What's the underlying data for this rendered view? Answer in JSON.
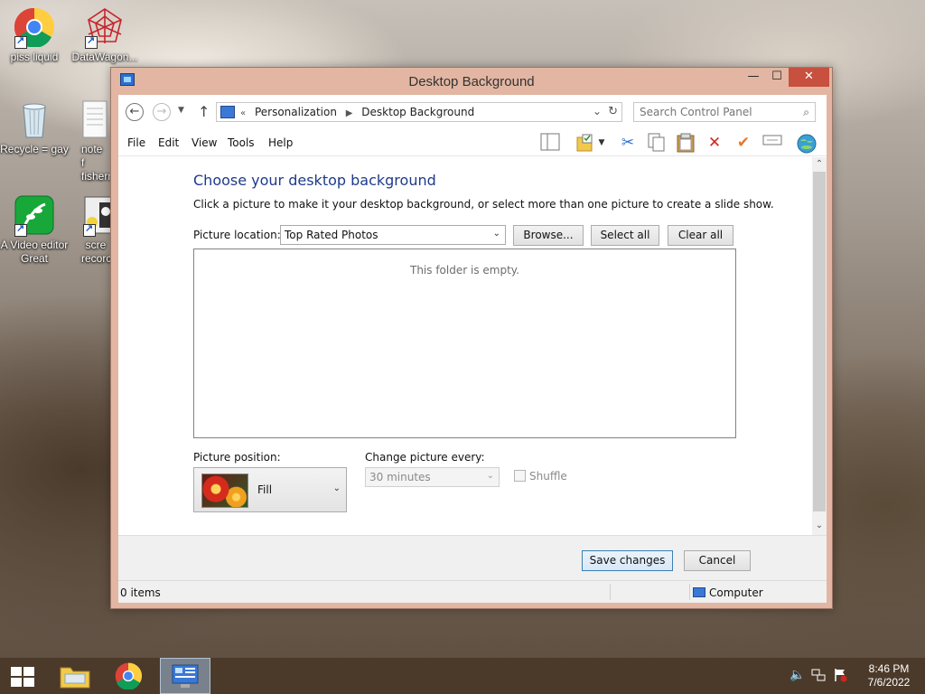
{
  "desktop": {
    "icons": [
      {
        "label": "piss liquid",
        "icon": "chrome-icon"
      },
      {
        "label": "DataWagon...",
        "icon": "datawagon-icon"
      },
      {
        "label": "Recycle = gay",
        "icon": "recycle-bin-icon"
      },
      {
        "label": "note f fishern",
        "icon": "notepad-icon"
      },
      {
        "label": "A Video editor Great",
        "icon": "video-editor-icon"
      },
      {
        "label": "scre recorc",
        "icon": "screen-recorder-icon"
      }
    ]
  },
  "window": {
    "title": "Desktop Background",
    "controls": {
      "minimize": "—",
      "maximize": "☐",
      "close": "✕"
    }
  },
  "address": {
    "overflow": "«",
    "crumbs": [
      "Personalization",
      "Desktop Background"
    ]
  },
  "search": {
    "placeholder": "Search Control Panel"
  },
  "menu": {
    "items": [
      "File",
      "Edit",
      "View",
      "Tools",
      "Help"
    ]
  },
  "toolbar": {
    "icons": [
      "layout-pane-icon",
      "folder-properties-icon",
      "dropdown-arrow-icon",
      "cut-icon",
      "copy-icon",
      "paste-icon",
      "delete-icon",
      "checkmark-icon",
      "rename-icon",
      "globe-icon"
    ]
  },
  "main": {
    "heading": "Choose your desktop background",
    "instructions": "Click a picture to make it your desktop background, or select more than one picture to create a slide show.",
    "picture_location_label": "Picture location:",
    "picture_location_value": "Top Rated Photos",
    "browse_label": "Browse...",
    "select_all_label": "Select all",
    "clear_all_label": "Clear all",
    "empty_message": "This folder is empty.",
    "picture_position_label": "Picture position:",
    "picture_position_value": "Fill",
    "change_every_label": "Change picture every:",
    "change_every_value": "30 minutes",
    "shuffle_label": "Shuffle",
    "shuffle_checked": false
  },
  "footer": {
    "save_label": "Save changes",
    "cancel_label": "Cancel"
  },
  "statusbar": {
    "items": "0 items",
    "location": "Computer"
  },
  "taskbar": {
    "apps": [
      "start-icon",
      "file-explorer-icon",
      "chrome-icon",
      "control-panel-icon"
    ],
    "active_app": "control-panel-icon",
    "time": "8:46 PM",
    "date": "7/6/2022"
  },
  "colors": {
    "window_frame": "#e2b6a2",
    "close_button": "#c7503f",
    "heading": "#1e3a8a",
    "taskbar": "#4a3828"
  }
}
